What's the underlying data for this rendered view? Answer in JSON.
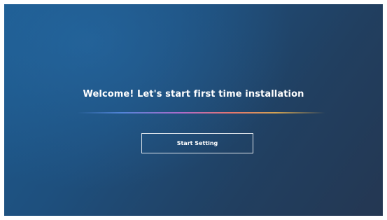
{
  "setup": {
    "welcome_message": "Welcome! Let's start first time installation",
    "start_button_label": "Start Setting"
  }
}
